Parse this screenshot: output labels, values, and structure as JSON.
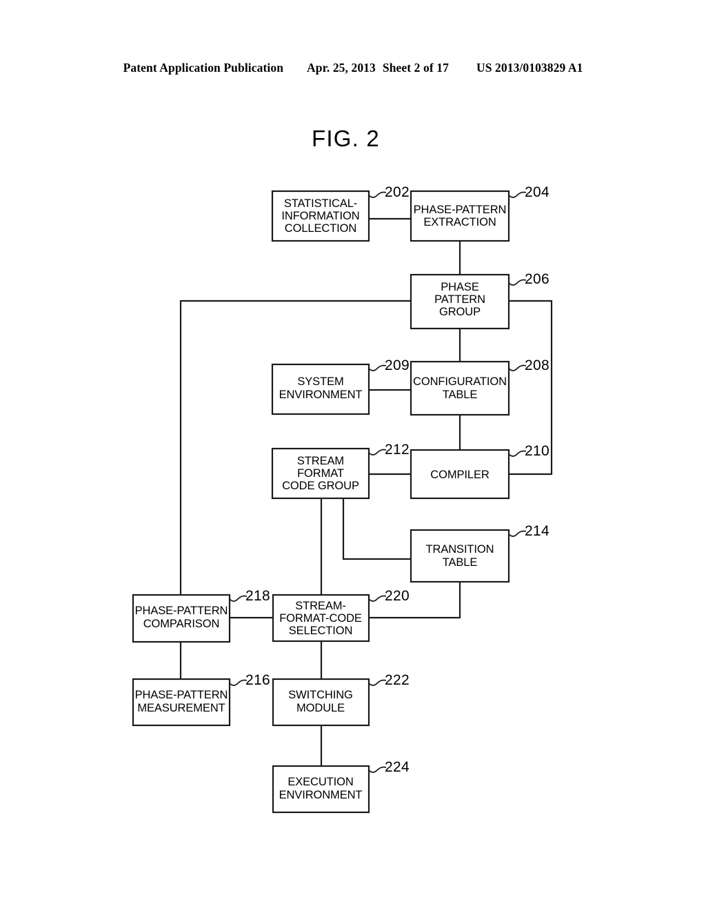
{
  "header": {
    "publication": "Patent Application Publication",
    "date": "Apr. 25, 2013",
    "sheet": "Sheet 2 of 17",
    "doc_number": "US 2013/0103829 A1"
  },
  "figure": {
    "title": "FIG. 2",
    "line_color": "#1a1a1a",
    "background": "#ffffff"
  },
  "nodes": [
    {
      "id": "n202",
      "ref": "202",
      "lines": [
        "STATISTICAL-",
        "INFORMATION",
        "COLLECTION"
      ]
    },
    {
      "id": "n204",
      "ref": "204",
      "lines": [
        "PHASE-PATTERN",
        "EXTRACTION"
      ]
    },
    {
      "id": "n206",
      "ref": "206",
      "lines": [
        "PHASE",
        "PATTERN",
        "GROUP"
      ]
    },
    {
      "id": "n209",
      "ref": "209",
      "lines": [
        "SYSTEM",
        "ENVIRONMENT"
      ]
    },
    {
      "id": "n208",
      "ref": "208",
      "lines": [
        "CONFIGURATION",
        "TABLE"
      ]
    },
    {
      "id": "n212",
      "ref": "212",
      "lines": [
        "STREAM",
        "FORMAT",
        "CODE GROUP"
      ]
    },
    {
      "id": "n210",
      "ref": "210",
      "lines": [
        "COMPILER"
      ]
    },
    {
      "id": "n214",
      "ref": "214",
      "lines": [
        "TRANSITION",
        "TABLE"
      ]
    },
    {
      "id": "n218",
      "ref": "218",
      "lines": [
        "PHASE-PATTERN",
        "COMPARISON"
      ]
    },
    {
      "id": "n220",
      "ref": "220",
      "lines": [
        "STREAM-",
        "FORMAT-CODE",
        "SELECTION"
      ]
    },
    {
      "id": "n216",
      "ref": "216",
      "lines": [
        "PHASE-PATTERN",
        "MEASUREMENT"
      ]
    },
    {
      "id": "n222",
      "ref": "222",
      "lines": [
        "SWITCHING",
        "MODULE"
      ]
    },
    {
      "id": "n224",
      "ref": "224",
      "lines": [
        "EXECUTION",
        "ENVIRONMENT"
      ]
    }
  ],
  "connections": [
    "202-right-to-204-left",
    "204-bottom-to-206-top",
    "206-left-down-to-218-top",
    "206-right-down-to-210-right",
    "209-right-to-208-left",
    "206-bottom-to-208-top",
    "208-bottom-to-210-top",
    "212-right-to-210-left",
    "212-bottom-to-220-top",
    "212-bottom-right-to-214-left",
    "214-bottom-down-left-to-220-right",
    "218-right-to-220-left",
    "218-bottom-to-216-top",
    "220-bottom-to-222-top",
    "222-bottom-to-224-top"
  ]
}
